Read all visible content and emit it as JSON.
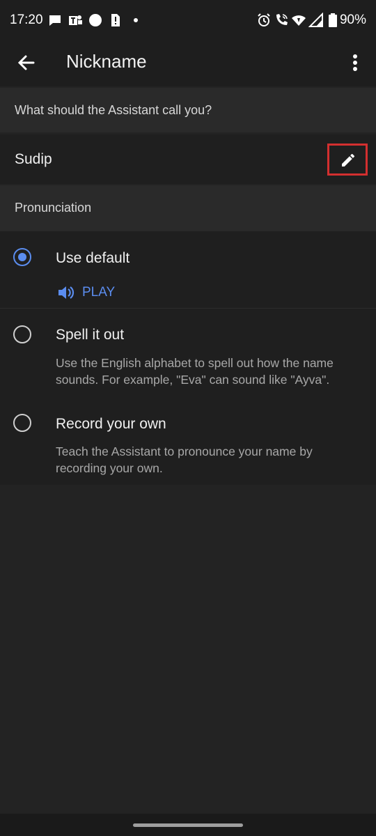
{
  "status_bar": {
    "time": "17:20",
    "battery": "90%",
    "icons": [
      "chat-bubble-icon",
      "teams-icon",
      "circle-icon",
      "sim-alert-icon",
      "dot-icon",
      "alarm-icon",
      "wifi-call-icon",
      "wifi-icon",
      "signal-icon",
      "battery-icon"
    ]
  },
  "app_bar": {
    "title": "Nickname"
  },
  "nickname_section": {
    "header": "What should the Assistant call you?",
    "value": "Sudip"
  },
  "pronunciation_section": {
    "header": "Pronunciation",
    "options": [
      {
        "label": "Use default",
        "selected": true,
        "action": "PLAY"
      },
      {
        "label": "Spell it out",
        "selected": false,
        "description": "Use the English alphabet to spell out how the name sounds. For example, \"Eva\" can sound like \"Ayva\"."
      },
      {
        "label": "Record your own",
        "selected": false,
        "description": "Teach the Assistant to pronounce your name by recording your own."
      }
    ]
  },
  "colors": {
    "accent": "#5b8def",
    "highlight_box": "#d32f2f",
    "background": "#232323"
  }
}
